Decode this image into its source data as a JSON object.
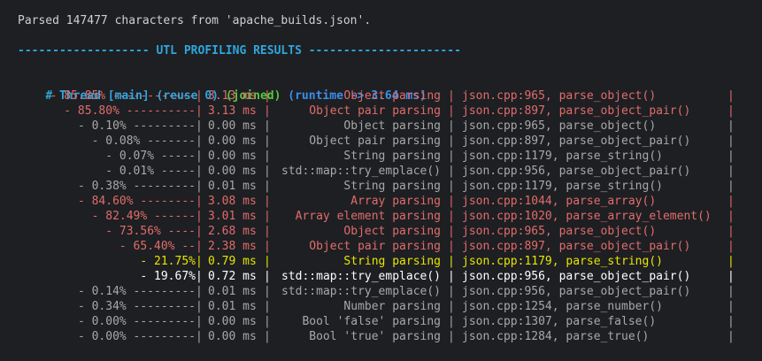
{
  "header": {
    "parsed_line": "Parsed 147477 characters from 'apache_builds.json'.",
    "title_line": "------------------- UTL PROFILING RESULTS ----------------------"
  },
  "thread": {
    "name": "# Thread [main]",
    "reuse": "(reuse 0)",
    "joined": "(joined)",
    "runtime": "(runtime -> 3.64 ms)"
  },
  "rows": [
    {
      "pct": "- 85.85% ------------",
      "time": "3.13 ms",
      "label": "Object parsing",
      "loc": "json.cpp:965, parse_object()",
      "color": "red"
    },
    {
      "pct": "- 85.80% ----------",
      "time": "3.13 ms",
      "label": "Object pair parsing",
      "loc": "json.cpp:897, parse_object_pair()",
      "color": "red"
    },
    {
      "pct": "- 0.10% ---------",
      "time": "0.00 ms",
      "label": "Object parsing",
      "loc": "json.cpp:965, parse_object()",
      "color": "gray"
    },
    {
      "pct": "- 0.08% -------",
      "time": "0.00 ms",
      "label": "Object pair parsing",
      "loc": "json.cpp:897, parse_object_pair()",
      "color": "gray"
    },
    {
      "pct": "- 0.07% -----",
      "time": "0.00 ms",
      "label": "String parsing",
      "loc": "json.cpp:1179, parse_string()",
      "color": "gray"
    },
    {
      "pct": "- 0.01% -----",
      "time": "0.00 ms",
      "label": "std::map::try_emplace()",
      "loc": "json.cpp:956, parse_object_pair()",
      "color": "gray"
    },
    {
      "pct": "- 0.38% ---------",
      "time": "0.01 ms",
      "label": "String parsing",
      "loc": "json.cpp:1179, parse_string()",
      "color": "gray"
    },
    {
      "pct": "- 84.60% --------",
      "time": "3.08 ms",
      "label": "Array parsing",
      "loc": "json.cpp:1044, parse_array()",
      "color": "red"
    },
    {
      "pct": "- 82.49% ------",
      "time": "3.01 ms",
      "label": "Array element parsing",
      "loc": "json.cpp:1020, parse_array_element()",
      "color": "red"
    },
    {
      "pct": "- 73.56% ----",
      "time": "2.68 ms",
      "label": "Object parsing",
      "loc": "json.cpp:965, parse_object()",
      "color": "red"
    },
    {
      "pct": "- 65.40% --",
      "time": "2.38 ms",
      "label": "Object pair parsing",
      "loc": "json.cpp:897, parse_object_pair()",
      "color": "red"
    },
    {
      "pct": "- 21.75%",
      "time": "0.79 ms",
      "label": "String parsing",
      "loc": "json.cpp:1179, parse_string()",
      "color": "yellow"
    },
    {
      "pct": "- 19.67%",
      "time": "0.72 ms",
      "label": "std::map::try_emplace()",
      "loc": "json.cpp:956, parse_object_pair()",
      "color": "white"
    },
    {
      "pct": "- 0.14% ---------",
      "time": "0.01 ms",
      "label": "std::map::try_emplace()",
      "loc": "json.cpp:956, parse_object_pair()",
      "color": "gray"
    },
    {
      "pct": "- 0.34% ---------",
      "time": "0.01 ms",
      "label": "Number parsing",
      "loc": "json.cpp:1254, parse_number()",
      "color": "gray"
    },
    {
      "pct": "- 0.00% ---------",
      "time": "0.00 ms",
      "label": "Bool 'false' parsing",
      "loc": "json.cpp:1307, parse_false()",
      "color": "gray"
    },
    {
      "pct": "- 0.00% ---------",
      "time": "0.00 ms",
      "label": "Bool 'true' parsing",
      "loc": "json.cpp:1284, parse_true()",
      "color": "gray"
    }
  ],
  "separator": "|",
  "colors": {
    "background": "#1e1f22",
    "red": "#e06c6c",
    "gray": "#a8a8a8",
    "yellow": "#e6e600",
    "white": "#ffffff",
    "cyan": "#2fa6dd",
    "green": "#56c93c",
    "blue": "#3b8eea"
  }
}
